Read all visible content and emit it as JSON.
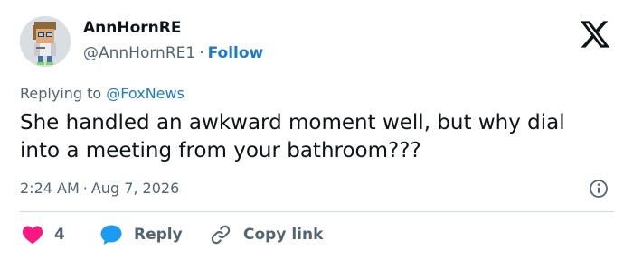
{
  "author": {
    "name": "AnnHornRE",
    "handle": "@AnnHornRE1",
    "separator": "·",
    "follow_label": "Follow"
  },
  "reply_context": {
    "prefix": "Replying to",
    "mention": "@FoxNews"
  },
  "tweet": {
    "text": "She handled an awkward moment well, but why dial into a meeting from your bathroom???"
  },
  "meta": {
    "time": "2:24 AM",
    "separator": "·",
    "date": "Aug 7, 2026"
  },
  "actions": {
    "like_count": "4",
    "reply_label": "Reply",
    "copy_link_label": "Copy link"
  },
  "colors": {
    "accent": "#1d7bc6",
    "like": "#f91880",
    "reply_bubble": "#1d9bf0",
    "muted_text": "#536471",
    "divider": "#cfd9de"
  },
  "icons": [
    "x-logo-icon",
    "info-icon",
    "heart-icon",
    "speech-bubble-icon",
    "link-icon"
  ]
}
